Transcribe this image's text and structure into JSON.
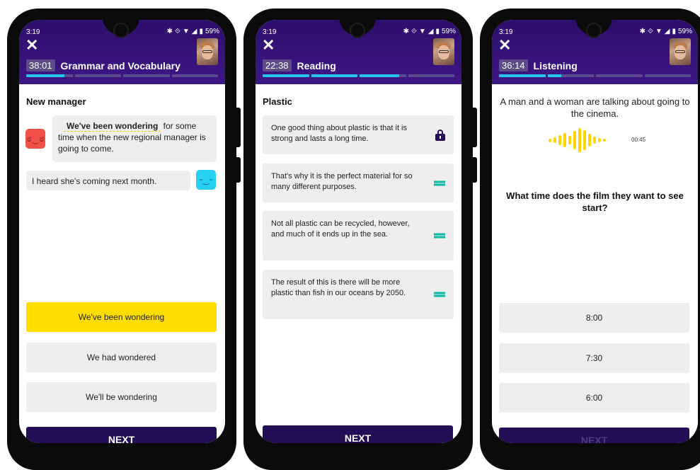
{
  "status": {
    "time": "3:19",
    "battery": "59%"
  },
  "screens": [
    {
      "timer": "38:01",
      "section": "Grammar and Vocabulary",
      "progress": [
        0.82,
        0,
        0,
        0
      ],
      "title": "New manager",
      "blank_text": "We've been wondering",
      "sentence_rest": "for some time when the new regional manager is going to come.",
      "reply": "I heard she's coming next month.",
      "answers": [
        "We've been wondering",
        "We had wondered",
        "We'll be wondering"
      ],
      "selected_answer": 0,
      "next_label": "NEXT",
      "emoji_speaker": "worried-face-icon",
      "emoji_listener": "smiling-face-icon"
    },
    {
      "timer": "22:38",
      "section": "Reading",
      "progress": [
        1,
        1,
        0.85,
        0
      ],
      "title": "Plastic",
      "paragraphs": [
        {
          "text": "One good thing about plastic is that it is strong and lasts a long time.",
          "icon": "lock-icon"
        },
        {
          "text": "That's why it is the perfect material for so many different purposes.",
          "icon": "drag-handle-icon"
        },
        {
          "text": "Not all plastic can be recycled, however, and much of it ends up in the sea.",
          "icon": "drag-handle-icon"
        },
        {
          "text": "The result of this is there will be more plastic than fish in our oceans by 2050.",
          "icon": "drag-handle-icon"
        }
      ],
      "next_label": "NEXT"
    },
    {
      "timer": "36:14",
      "section": "Listening",
      "progress": [
        1,
        0.3,
        0,
        0
      ],
      "prompt": "A man and a woman are talking about going to the cinema.",
      "audio_time": "00:45",
      "question": "What time does the film they want to see start?",
      "answers": [
        "8:00",
        "7:30",
        "6:00"
      ],
      "next_label": "NEXT"
    }
  ],
  "colors": {
    "header": "#2e0e6b",
    "progress_fill": "#23c6ea",
    "selected": "#ffdd00",
    "next_bg": "#250d56",
    "handle": "#0ab8a6",
    "wave": "#ffd400"
  }
}
